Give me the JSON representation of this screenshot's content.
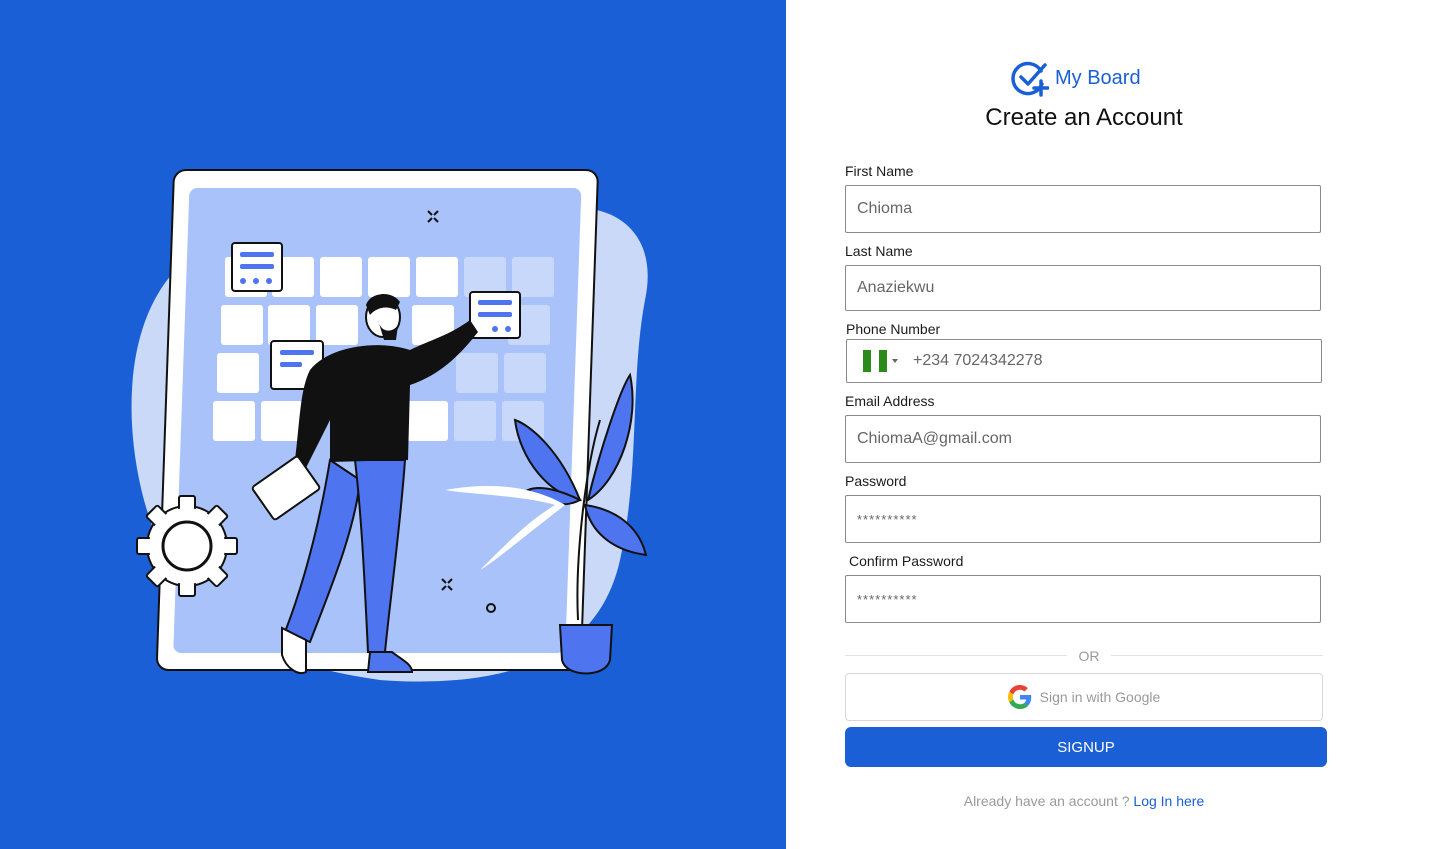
{
  "brand": {
    "name": "My Board",
    "logo_icon": "check-circle-plus-icon",
    "accent_color": "#1a5fd6"
  },
  "page": {
    "title": "Create an Account"
  },
  "form": {
    "first_name": {
      "label": "First Name",
      "value": "Chioma"
    },
    "last_name": {
      "label": "Last Name",
      "value": "Anaziekwu"
    },
    "phone": {
      "label": "Phone Number",
      "value": "+234 7024342278",
      "country_flag": "nigeria-flag-icon",
      "flag_colors": [
        "#2a8a1a",
        "#ffffff",
        "#2a8a1a"
      ]
    },
    "email": {
      "label": "Email Address",
      "value": "ChiomaA@gmail.com"
    },
    "password": {
      "label": "Password",
      "value": "**********"
    },
    "confirm_password": {
      "label": "Confirm Password",
      "value": "**********"
    }
  },
  "divider": {
    "text": "OR"
  },
  "google_button": {
    "label": "Sign in with Google",
    "icon": "google-icon"
  },
  "signup_button": {
    "label": "SIGNUP"
  },
  "footer": {
    "prompt": "Already have an account ?",
    "link": "Log In here"
  },
  "illustration": {
    "subject": "person-arranging-calendar-board-illustration",
    "background_color": "#1a5fd6"
  }
}
